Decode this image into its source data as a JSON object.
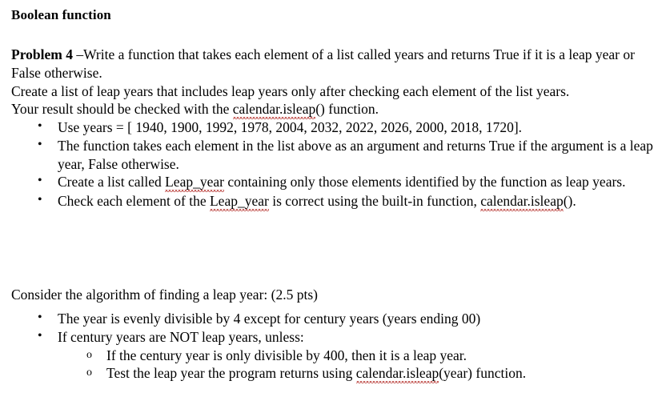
{
  "document": {
    "heading": "Boolean function",
    "intro": {
      "problem_label": "Problem 4",
      "problem_rest": " –Write a function that takes each element of a list called years and returns True if it is a leap year or False otherwise.",
      "line2": "Create a list of leap years that includes leap years only after checking each element of the list years.",
      "line3_before": "Your result should be checked with the ",
      "line3_spell": "calendar.isleap",
      "line3_after": "() function."
    },
    "main_bullets": [
      {
        "id": "use-years",
        "text": "Use years = [ 1940, 1900, 1992, 1978, 2004, 2032, 2022, 2026, 2000, 2018, 1720].",
        "years": [
          1940,
          1900,
          1992,
          1978,
          2004,
          2032,
          2022,
          2026,
          2000,
          2018,
          1720
        ]
      },
      {
        "id": "function-behavior",
        "text": "The function takes each element in the list above as an argument and returns True if the argument is a leap year, False otherwise."
      },
      {
        "id": "create-leap-year-list",
        "before": "Create a list called ",
        "spell": "Leap_year",
        "after": " containing only those elements identified by the function as leap years."
      },
      {
        "id": "check-with-builtin",
        "before": "Check each element of the ",
        "spell": "Leap_year",
        "middle": " is correct using the built-in function, ",
        "spell2": "calendar.isleap",
        "after": "()."
      }
    ],
    "algorithm": {
      "lead_in": "Consider the algorithm of finding a leap year: (2.5 pts)",
      "points": "2.5 pts",
      "bullets": [
        {
          "id": "divisible-by-4",
          "text": "The year is evenly divisible by 4 except for century years (years ending 00)"
        },
        {
          "id": "century-years",
          "text": "If century years are NOT leap years, unless:",
          "sub": [
            {
              "id": "divisible-by-400",
              "text": "If the century year is only divisible by 400, then it is a leap year."
            },
            {
              "id": "test-with-isleap",
              "before": "Test the leap year the program returns using ",
              "spell": "calendar.isleap",
              "after": "(year) function."
            }
          ]
        }
      ]
    }
  },
  "colors": {
    "text": "#000000",
    "background": "#ffffff",
    "spellcheck_underline": "#b5312c"
  }
}
